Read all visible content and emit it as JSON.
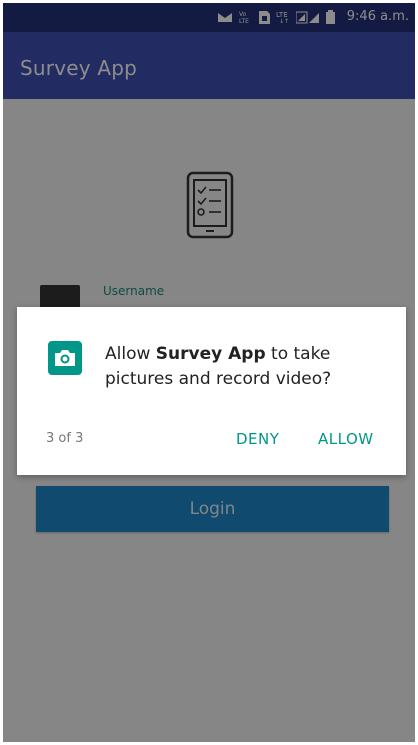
{
  "status_bar": {
    "time": "9:46 a.m.",
    "icons": [
      "notification-icon",
      "volte-icon",
      "sim-icon",
      "lte-icon",
      "signal-icon",
      "battery-icon"
    ]
  },
  "app_bar": {
    "title": "Survey App"
  },
  "login_form": {
    "logo_icon": "survey-clipboard-icon",
    "username_label": "Username",
    "login_button": "Login"
  },
  "permission_dialog": {
    "icon": "camera-icon",
    "message_prefix": "Allow ",
    "app_name": "Survey App",
    "message_suffix": " to take pictures and record video?",
    "counter": "3 of 3",
    "deny_label": "DENY",
    "allow_label": "ALLOW"
  },
  "colors": {
    "status_bar": "#25327a",
    "app_bar": "#3f51b5",
    "login_button": "#1e88c8",
    "accent": "#009688"
  }
}
